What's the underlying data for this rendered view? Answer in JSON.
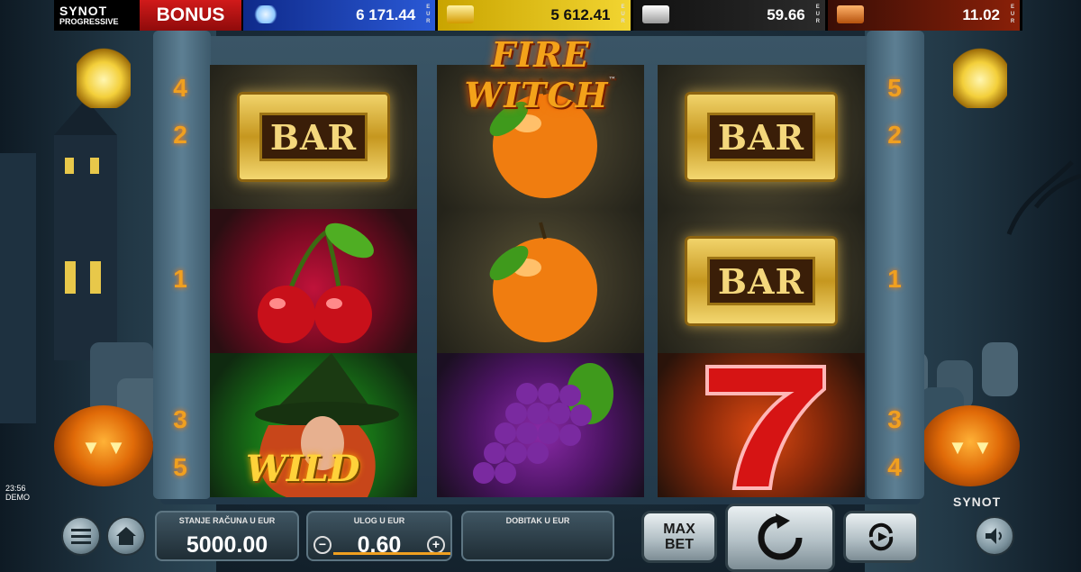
{
  "jackpot": {
    "brand": "SYNOT",
    "brand_sub": "PROGRESSIVE",
    "bonus_label": "BONUS",
    "tiers": [
      {
        "icon": "diamond-icon",
        "value": "6 171.44",
        "color": "#2a59d6"
      },
      {
        "icon": "gold-bar-icon",
        "value": "5 612.41",
        "color": "#f2d531"
      },
      {
        "icon": "silver-bar-icon",
        "value": "59.66",
        "color": "#2b2b2b"
      },
      {
        "icon": "bronze-bar-icon",
        "value": "11.02",
        "color": "#8a2008"
      }
    ],
    "currency_vertical": "EUR"
  },
  "game": {
    "title": "FIRE WITCH",
    "trademark": "™"
  },
  "paylines": {
    "left": [
      "4",
      "2",
      "1",
      "3",
      "5"
    ],
    "right": [
      "5",
      "2",
      "1",
      "3",
      "4"
    ]
  },
  "reels": [
    [
      "BAR",
      "cherry",
      "wild"
    ],
    [
      "orange",
      "orange",
      "grapes"
    ],
    [
      "BAR",
      "BAR",
      "seven"
    ]
  ],
  "symbols": {
    "bar_label": "BAR",
    "wild_label": "WILD"
  },
  "controls": {
    "balance_label": "STANJE RAČUNA U EUR",
    "balance_value": "5000.00",
    "bet_label": "ULOG U EUR",
    "bet_value": "0.60",
    "minus": "−",
    "plus": "+",
    "win_label": "DOBITAK U EUR",
    "win_value": "",
    "max_bet_line1": "MAX",
    "max_bet_line2": "BET",
    "spin_icon": "spin-arrow-icon",
    "autoplay_icon": "autoplay-icon",
    "menu_icon": "hamburger-menu-icon",
    "home_icon": "home-icon",
    "sound_icon": "speaker-icon"
  },
  "status": {
    "time": "23:56",
    "mode": "DEMO",
    "provider": "SYNOT"
  },
  "accent": "#f0a020"
}
